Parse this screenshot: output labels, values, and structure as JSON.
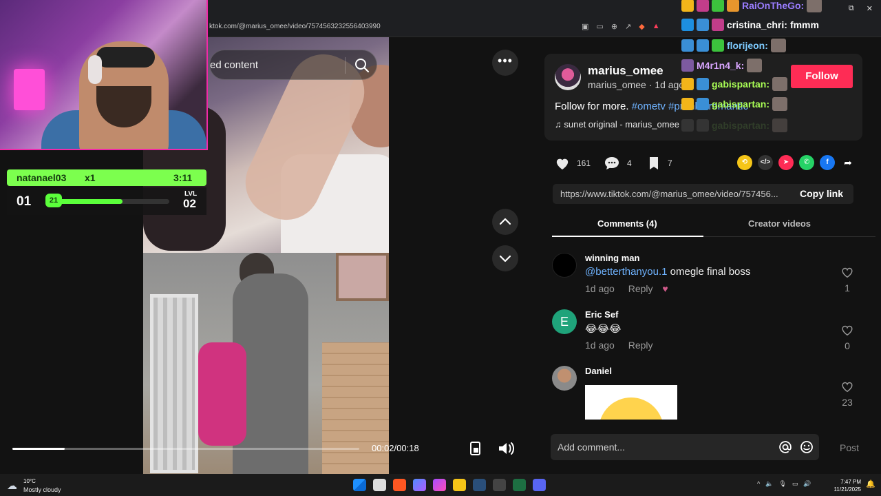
{
  "browser": {
    "url": "ktok.com/@marius_omee/video/7574563232556403990"
  },
  "search": {
    "text": "ed content"
  },
  "video": {
    "time": "00:02/00:18",
    "progress_fraction": 0.15
  },
  "stream_widget": {
    "username": "natanael03",
    "multiplier": "x1",
    "timer": "3:11",
    "level_current": "01",
    "level_progress": "21",
    "progress_fraction": 0.62,
    "level_label": "LVL",
    "level_next": "02"
  },
  "author": {
    "display_name": "marius_omee",
    "handle": "marius_omee",
    "posted": "1d ago",
    "follow_label": "Follow",
    "desc_prefix": "Follow for more.",
    "tags": [
      "#ometv",
      "#prank",
      "#romantic"
    ],
    "music": "sunet original - marius_omee"
  },
  "stats": {
    "likes": "161",
    "comments": "4",
    "saves": "7"
  },
  "link": {
    "url": "https://www.tiktok.com/@marius_omee/video/757456...",
    "copy_label": "Copy link"
  },
  "tabs": {
    "comments": "Comments (4)",
    "creator": "Creator videos"
  },
  "comments": [
    {
      "name": "winning man",
      "mention": "@betterthanyou.1",
      "text": "omegle final boss",
      "time": "1d ago",
      "reply": "Reply",
      "likes": "1"
    },
    {
      "name": "Eric Sef",
      "avatar_letter": "E",
      "text": "😂😂😂",
      "time": "1d ago",
      "reply": "Reply",
      "likes": "0"
    },
    {
      "name": "Daniel",
      "likes": "23"
    }
  ],
  "composer": {
    "placeholder": "Add comment...",
    "post_label": "Post"
  },
  "chat": [
    {
      "user": "RaiOnTheGo:",
      "color": "#9a7dff",
      "msg": ""
    },
    {
      "user": "cristina_chri:",
      "color": "#ffffff",
      "msg": "fmmm"
    },
    {
      "user": "florijeon:",
      "color": "#7ecbff",
      "msg": ""
    },
    {
      "user": "M4r1n4_k:",
      "color": "#d9a6ff",
      "msg": ""
    },
    {
      "user": "gabispartan:",
      "color": "#aaff55",
      "msg": ""
    },
    {
      "user": "gabispartan:",
      "color": "#aaff55",
      "msg": ""
    },
    {
      "user": "gabispartan:",
      "color": "#4a6a3a",
      "msg": ""
    }
  ],
  "taskbar": {
    "temp": "10°C",
    "condition": "Mostly cloudy",
    "time": "7:47 PM",
    "date": "11/21/2025"
  },
  "colors": {
    "accent": "#fe2c55",
    "link": "#6fb3ff",
    "widget_green": "#7cff4e"
  }
}
